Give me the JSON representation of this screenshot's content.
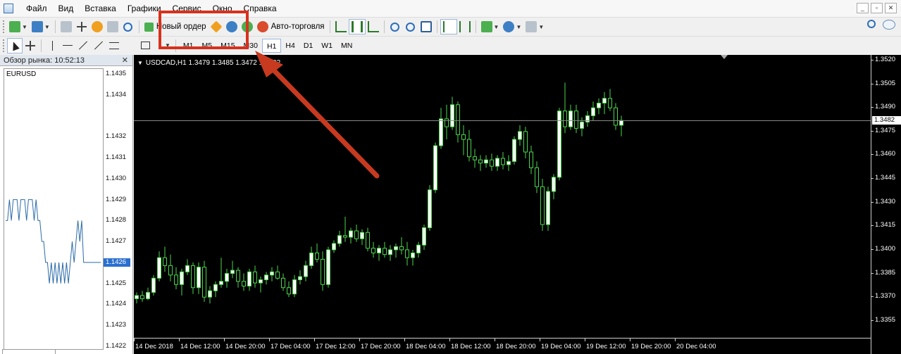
{
  "menu": [
    "Файл",
    "Вид",
    "Вставка",
    "Графики",
    "Сервис",
    "Окно",
    "Справка"
  ],
  "toolbar": {
    "new_order_label": "Новый ордер",
    "autotrading_label": "Авто-торговля",
    "timeframes": [
      "M1",
      "M5",
      "M15",
      "M30",
      "H1",
      "H4",
      "D1",
      "W1",
      "MN"
    ],
    "active_timeframe": "H1"
  },
  "market_watch": {
    "title": "Обзор рынка: 10:52:13",
    "symbol": "EURUSD",
    "price_ticks": [
      "1.1435",
      "1.1434",
      "1.1432",
      "1.1431",
      "1.1430",
      "1.1429",
      "1.1428",
      "1.1427",
      "1.1426",
      "1.1425",
      "1.1424",
      "1.1423",
      "1.1422"
    ],
    "current_price": "1.1426",
    "tick_prices": [
      1.1428,
      1.1428,
      1.1429,
      1.1428,
      1.1429,
      1.1429,
      1.1429,
      1.1428,
      1.1429,
      1.1429,
      1.1429,
      1.1428,
      1.1429,
      1.1429,
      1.1429,
      1.1428,
      1.1429,
      1.1428,
      1.1428,
      1.1427,
      1.1427,
      1.1426,
      1.1426,
      1.1425,
      1.1426,
      1.1425,
      1.1426,
      1.1425,
      1.1426,
      1.1425,
      1.1426,
      1.1425,
      1.1426,
      1.1425,
      1.1426,
      1.1427,
      1.1426,
      1.1427,
      1.1428,
      1.1427,
      1.1428,
      1.1426,
      1.1426,
      1.1426,
      1.1426,
      1.1426,
      1.1426,
      1.1426,
      1.1426,
      1.1426,
      1.1426
    ]
  },
  "chart": {
    "title": "USDCAD,H1  1.3479 1.3485 1.3472 1.3482",
    "y_ticks": [
      "1.3520",
      "1.3505",
      "1.3490",
      "1.3475",
      "1.3460",
      "1.3445",
      "1.3430",
      "1.3415",
      "1.3400",
      "1.3385",
      "1.3370",
      "1.3355"
    ],
    "current_price": "1.3482",
    "x_ticks": [
      "14 Dec 2018",
      "14 Dec 12:00",
      "14 Dec 20:00",
      "17 Dec 04:00",
      "17 Dec 12:00",
      "17 Dec 20:00",
      "18 Dec 04:00",
      "18 Dec 12:00",
      "18 Dec 20:00",
      "19 Dec 04:00",
      "19 Dec 12:00",
      "19 Dec 20:00",
      "20 Dec 04:00"
    ],
    "colors": {
      "background": "#000000",
      "bull": "#ffffff",
      "bear": "#000000",
      "wick": "#4cd64c",
      "text": "#ffffff"
    }
  },
  "chart_data": {
    "type": "candlestick",
    "symbol": "USDCAD",
    "timeframe": "H1",
    "ylim": [
      1.335,
      1.352
    ],
    "ohlc": [
      [
        1.3369,
        1.3373,
        1.3366,
        1.3371
      ],
      [
        1.3371,
        1.3374,
        1.3367,
        1.3369
      ],
      [
        1.3369,
        1.3376,
        1.3368,
        1.3373
      ],
      [
        1.3373,
        1.3384,
        1.3371,
        1.3382
      ],
      [
        1.3382,
        1.3399,
        1.338,
        1.3395
      ],
      [
        1.3395,
        1.3402,
        1.3386,
        1.339
      ],
      [
        1.339,
        1.3397,
        1.338,
        1.3384
      ],
      [
        1.3384,
        1.3389,
        1.3375,
        1.3378
      ],
      [
        1.3378,
        1.3388,
        1.3371,
        1.3386
      ],
      [
        1.3386,
        1.3394,
        1.3384,
        1.339
      ],
      [
        1.339,
        1.3392,
        1.3372,
        1.3376
      ],
      [
        1.3376,
        1.3392,
        1.3372,
        1.3389
      ],
      [
        1.3389,
        1.3393,
        1.3367,
        1.337
      ],
      [
        1.337,
        1.3377,
        1.3366,
        1.3374
      ],
      [
        1.3374,
        1.338,
        1.337,
        1.3378
      ],
      [
        1.3378,
        1.3395,
        1.3376,
        1.338
      ],
      [
        1.338,
        1.3388,
        1.3376,
        1.3385
      ],
      [
        1.3385,
        1.3393,
        1.3382,
        1.3387
      ],
      [
        1.3387,
        1.3389,
        1.3376,
        1.338
      ],
      [
        1.338,
        1.3385,
        1.3374,
        1.3377
      ],
      [
        1.3377,
        1.3388,
        1.3374,
        1.3386
      ],
      [
        1.3386,
        1.339,
        1.3376,
        1.3379
      ],
      [
        1.3379,
        1.3383,
        1.3373,
        1.3381
      ],
      [
        1.3381,
        1.3386,
        1.3378,
        1.3384
      ],
      [
        1.3384,
        1.3389,
        1.338,
        1.3386
      ],
      [
        1.3386,
        1.339,
        1.3381,
        1.3382
      ],
      [
        1.3382,
        1.3385,
        1.3374,
        1.3376
      ],
      [
        1.3376,
        1.338,
        1.337,
        1.3372
      ],
      [
        1.3372,
        1.3384,
        1.337,
        1.3381
      ],
      [
        1.3381,
        1.3387,
        1.3378,
        1.3383
      ],
      [
        1.3383,
        1.3393,
        1.338,
        1.339
      ],
      [
        1.339,
        1.3402,
        1.3388,
        1.3398
      ],
      [
        1.3398,
        1.3404,
        1.3392,
        1.3394
      ],
      [
        1.3394,
        1.3399,
        1.3374,
        1.3378
      ],
      [
        1.3378,
        1.3402,
        1.3376,
        1.34
      ],
      [
        1.34,
        1.3406,
        1.3398,
        1.3404
      ],
      [
        1.3404,
        1.3412,
        1.3402,
        1.3409
      ],
      [
        1.3409,
        1.3421,
        1.3405,
        1.3408
      ],
      [
        1.3408,
        1.3414,
        1.3404,
        1.3412
      ],
      [
        1.3412,
        1.3416,
        1.3405,
        1.3407
      ],
      [
        1.3407,
        1.3413,
        1.3403,
        1.3411
      ],
      [
        1.3411,
        1.3414,
        1.3399,
        1.3401
      ],
      [
        1.3401,
        1.3405,
        1.3395,
        1.3398
      ],
      [
        1.3398,
        1.3403,
        1.3393,
        1.3401
      ],
      [
        1.3401,
        1.3405,
        1.3395,
        1.3397
      ],
      [
        1.3397,
        1.3403,
        1.3393,
        1.34
      ],
      [
        1.34,
        1.3404,
        1.3395,
        1.3402
      ],
      [
        1.3402,
        1.3408,
        1.3397,
        1.34
      ],
      [
        1.34,
        1.3405,
        1.339,
        1.3395
      ],
      [
        1.3395,
        1.34,
        1.339,
        1.3398
      ],
      [
        1.3398,
        1.3405,
        1.3395,
        1.3403
      ],
      [
        1.3403,
        1.3416,
        1.34,
        1.3414
      ],
      [
        1.3414,
        1.3441,
        1.3412,
        1.3438
      ],
      [
        1.3438,
        1.3468,
        1.3436,
        1.3466
      ],
      [
        1.3466,
        1.349,
        1.3464,
        1.3483
      ],
      [
        1.3483,
        1.3492,
        1.347,
        1.3478
      ],
      [
        1.3478,
        1.3497,
        1.3476,
        1.3492
      ],
      [
        1.3492,
        1.3494,
        1.3468,
        1.3473
      ],
      [
        1.3473,
        1.3479,
        1.346,
        1.347
      ],
      [
        1.347,
        1.3476,
        1.3456,
        1.3459
      ],
      [
        1.3459,
        1.3464,
        1.3452,
        1.3457
      ],
      [
        1.3457,
        1.346,
        1.345,
        1.3455
      ],
      [
        1.3455,
        1.346,
        1.3452,
        1.3457
      ],
      [
        1.3457,
        1.3461,
        1.345,
        1.3453
      ],
      [
        1.3453,
        1.346,
        1.345,
        1.3458
      ],
      [
        1.3458,
        1.3462,
        1.3451,
        1.3454
      ],
      [
        1.3454,
        1.346,
        1.345,
        1.3456
      ],
      [
        1.3456,
        1.3472,
        1.3454,
        1.347
      ],
      [
        1.347,
        1.3479,
        1.3466,
        1.3475
      ],
      [
        1.3475,
        1.3478,
        1.3458,
        1.3462
      ],
      [
        1.3462,
        1.3466,
        1.3448,
        1.3452
      ],
      [
        1.3452,
        1.3456,
        1.3436,
        1.344
      ],
      [
        1.344,
        1.3445,
        1.3412,
        1.3416
      ],
      [
        1.3416,
        1.344,
        1.3412,
        1.3437
      ],
      [
        1.3437,
        1.3448,
        1.3432,
        1.3446
      ],
      [
        1.3446,
        1.349,
        1.3444,
        1.3488
      ],
      [
        1.3488,
        1.3506,
        1.3474,
        1.3478
      ],
      [
        1.3478,
        1.3492,
        1.3476,
        1.3488
      ],
      [
        1.3488,
        1.3492,
        1.3474,
        1.3477
      ],
      [
        1.3477,
        1.3484,
        1.3472,
        1.3481
      ],
      [
        1.3481,
        1.3488,
        1.3478,
        1.3485
      ],
      [
        1.3485,
        1.3494,
        1.3482,
        1.349
      ],
      [
        1.349,
        1.3496,
        1.3486,
        1.3493
      ],
      [
        1.3493,
        1.35,
        1.3486,
        1.3496
      ],
      [
        1.3496,
        1.3502,
        1.3488,
        1.349
      ],
      [
        1.349,
        1.3493,
        1.3476,
        1.3479
      ],
      [
        1.3479,
        1.3485,
        1.3472,
        1.3482
      ]
    ],
    "current_price": 1.3482
  }
}
